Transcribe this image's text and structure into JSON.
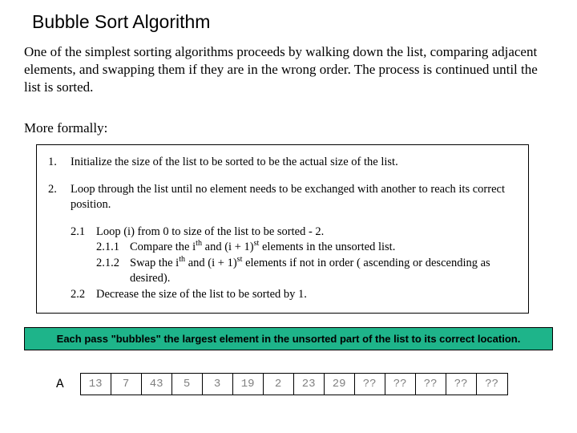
{
  "title": "Bubble Sort Algorithm",
  "intro": "One of the simplest sorting algorithms proceeds by walking down the list, comparing adjacent elements, and swapping them if they are in the wrong order.  The process is continued until the list is sorted.",
  "formal": "More formally:",
  "steps": {
    "s1_num": "1.",
    "s1_text": "Initialize the size of the list to be sorted to be the actual size of the list.",
    "s2_num": "2.",
    "s2_text": "Loop through the list until no element needs to be exchanged with another to reach its correct position.",
    "s21_num": "2.1",
    "s21_text": "Loop (i) from 0 to size of the list to be sorted - 2.",
    "s211_num": "2.1.1",
    "s211_pre": "Compare the i",
    "s211_sup1": "th",
    "s211_mid": " and (i + 1)",
    "s211_sup2": "st",
    "s211_post": " elements in the unsorted list.",
    "s212_num": "2.1.2",
    "s212_pre": "Swap the i",
    "s212_sup1": "th",
    "s212_mid": " and (i + 1)",
    "s212_sup2": "st",
    "s212_post": " elements if not in order ( ascending or descending as desired).",
    "s22_num": "2.2",
    "s22_text": "Decrease the size of the list to be sorted by 1."
  },
  "callout": "Each pass \"bubbles\" the largest element in the unsorted part of the list to its correct location.",
  "array_label": "A",
  "array": [
    "13",
    "7",
    "43",
    "5",
    "3",
    "19",
    "2",
    "23",
    "29",
    "??",
    "??",
    "??",
    "??",
    "??"
  ]
}
